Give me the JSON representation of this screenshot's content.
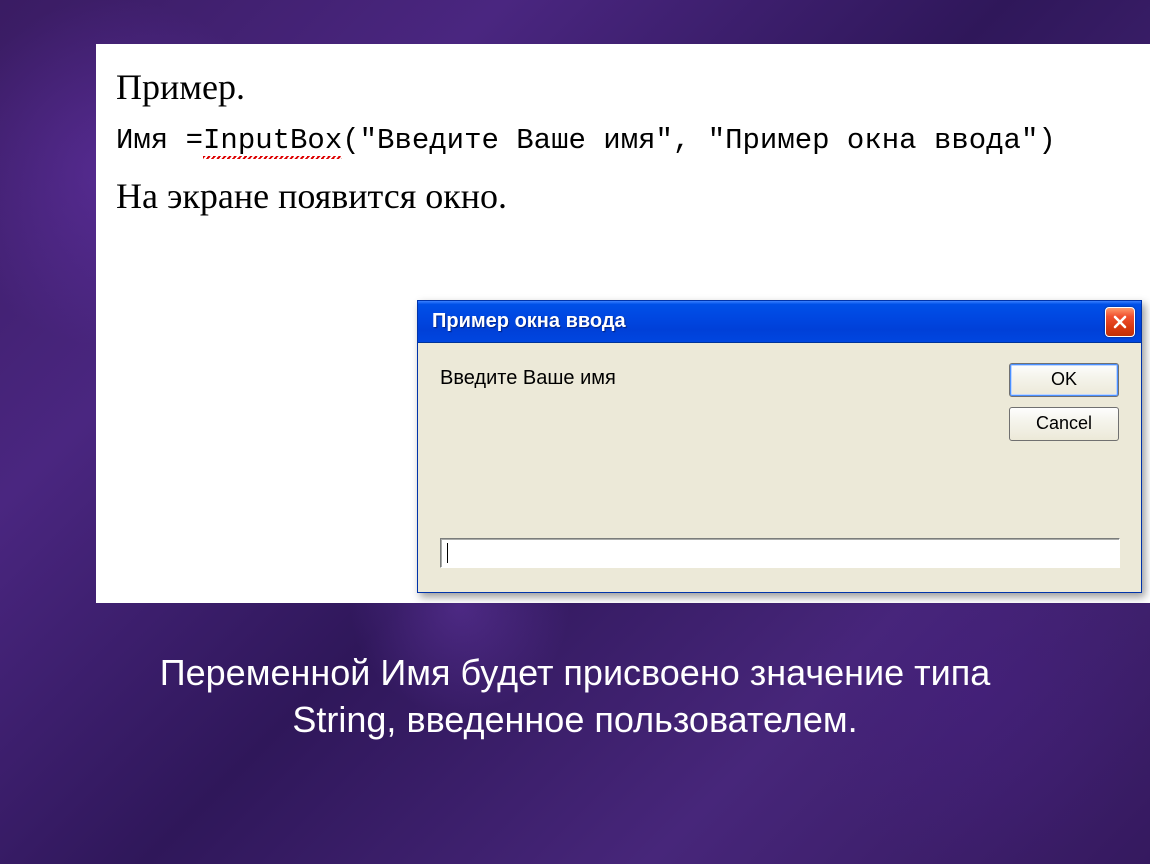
{
  "document": {
    "heading": "Пример.",
    "code_prefix": "Имя =",
    "code_func": "InputBox",
    "code_args": "(\"Введите Ваше имя\", \"Пример окна ввода\")",
    "line2": "На экране появится окно."
  },
  "dialog": {
    "title": "Пример окна ввода",
    "prompt": "Введите Ваше имя",
    "ok_label": "OK",
    "cancel_label": "Cancel",
    "input_value": ""
  },
  "caption": "Переменной Имя будет присвоено значение типа String, введенное пользователем."
}
